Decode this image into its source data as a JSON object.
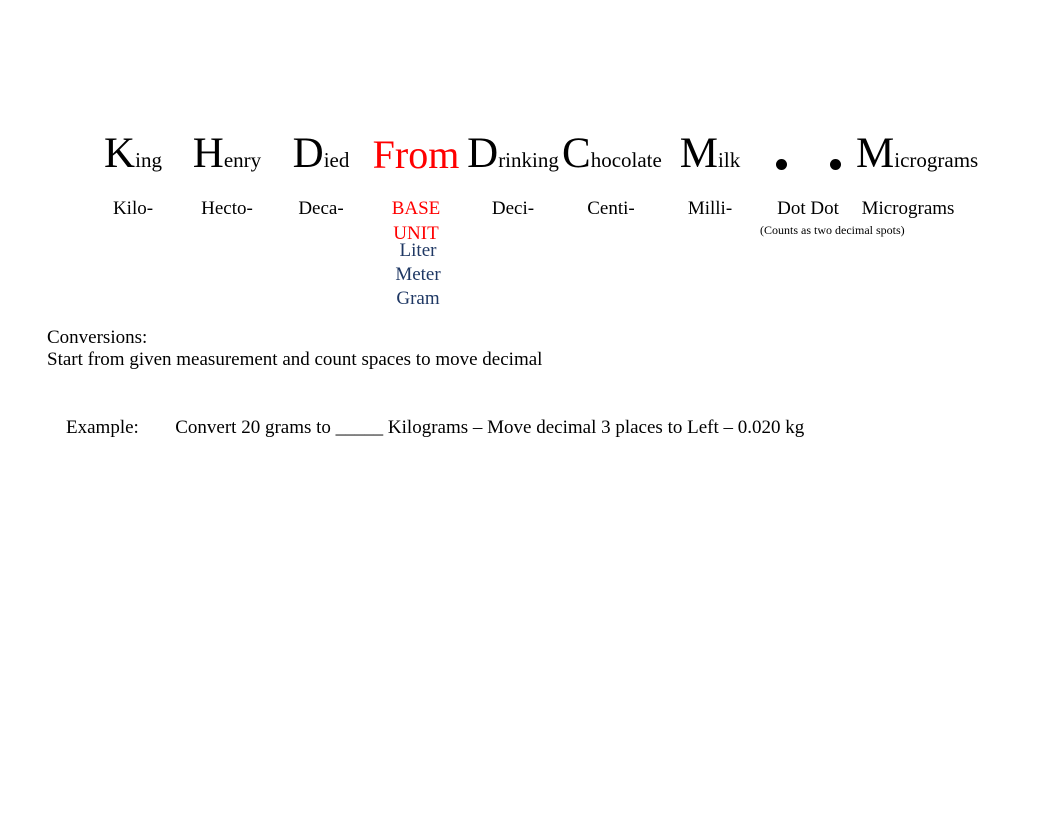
{
  "chart": {
    "mnemonic": [
      {
        "initial": "K",
        "rest": "ing",
        "color": "black"
      },
      {
        "initial": "H",
        "rest": "enry",
        "color": "black"
      },
      {
        "initial": "D",
        "rest": "ied",
        "color": "black"
      },
      {
        "initial": "From",
        "rest": "",
        "color": "#ff0000"
      },
      {
        "initial": "D",
        "rest": "rinking",
        "color": "black"
      },
      {
        "initial": "C",
        "rest": "hocolate",
        "color": "black"
      },
      {
        "initial": "M",
        "rest": "ilk",
        "color": "black"
      },
      {
        "initial": "",
        "rest": "",
        "color": "black",
        "icon": "decimal-dots"
      },
      {
        "initial": "M",
        "rest": "icrograms",
        "color": "black"
      }
    ],
    "prefixes": [
      {
        "label": "Kilo-",
        "color": "black"
      },
      {
        "label": "Hecto-",
        "color": "black"
      },
      {
        "label": "Deca-",
        "color": "black"
      },
      {
        "label": "BASE\nUNIT",
        "color": "#ff0000"
      },
      {
        "label": "Deci-",
        "color": "black"
      },
      {
        "label": "Centi-",
        "color": "black"
      },
      {
        "label": "Milli-",
        "color": "black"
      },
      {
        "label": "Dot Dot",
        "color": "black",
        "note": "(Counts as two decimal spots)"
      },
      {
        "label": "Micrograms",
        "color": "black"
      }
    ],
    "base_units": [
      "Liter",
      "Meter",
      "Gram"
    ],
    "base_unit_color": "#1f3864",
    "accent_red": "#ff0000"
  },
  "body": {
    "conversions_heading": "Conversions:",
    "instruction": "Start from given measurement and count spaces to move decimal",
    "example_label": "Example:",
    "example_text": "Convert 20 grams to _____ Kilograms – Move decimal 3 places to Left – 0.020 kg"
  }
}
